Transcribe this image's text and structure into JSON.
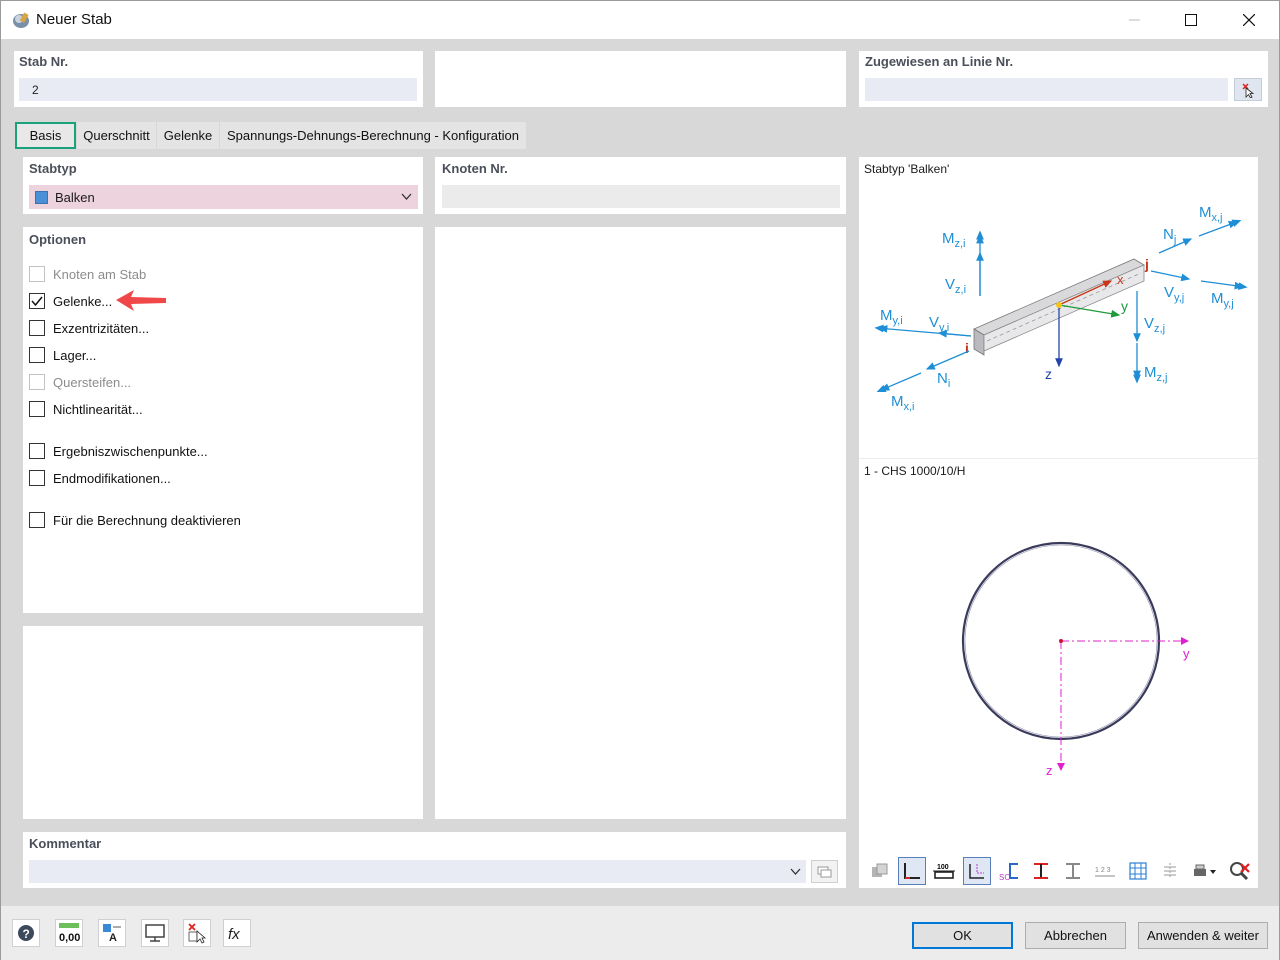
{
  "window": {
    "title": "Neuer Stab"
  },
  "header": {
    "stab_nr_label": "Stab Nr.",
    "stab_nr_value": "2",
    "zugewiesen_label": "Zugewiesen an Linie Nr.",
    "zugewiesen_value": ""
  },
  "tabs": [
    {
      "label": "Basis",
      "active": true
    },
    {
      "label": "Querschnitt"
    },
    {
      "label": "Gelenke"
    },
    {
      "label": "Spannungs-Dehnungs-Berechnung - Konfiguration"
    }
  ],
  "stabtyp": {
    "label": "Stabtyp",
    "value": "Balken",
    "swatch_color": "#4a90d9"
  },
  "knoten": {
    "label": "Knoten Nr.",
    "value": ""
  },
  "optionen": {
    "label": "Optionen",
    "items": [
      {
        "label": "Knoten am Stab",
        "checked": false,
        "disabled": true
      },
      {
        "label": "Gelenke...",
        "checked": true,
        "disabled": false
      },
      {
        "label": "Exzentrizitäten...",
        "checked": false,
        "disabled": false
      },
      {
        "label": "Lager...",
        "checked": false,
        "disabled": false
      },
      {
        "label": "Quersteifen...",
        "checked": false,
        "disabled": true
      },
      {
        "label": "Nichtlinearität...",
        "checked": false,
        "disabled": false
      },
      {
        "label": "Ergebniszwischenpunkte...",
        "checked": false,
        "disabled": false
      },
      {
        "label": "Endmodifikationen...",
        "checked": false,
        "disabled": false
      },
      {
        "label": "Für die Berechnung deaktivieren",
        "checked": false,
        "disabled": false
      }
    ]
  },
  "kommentar": {
    "label": "Kommentar",
    "value": ""
  },
  "preview": {
    "stabtyp_title": "Stabtyp 'Balken'",
    "section_title": "1 - CHS 1000/10/H",
    "force_color": "#1e8fd6",
    "labels": {
      "mzi": "M",
      "mzi_sub": "z,i",
      "vzi": "V",
      "vzi_sub": "z,i",
      "myi": "M",
      "myi_sub": "y,i",
      "vyi": "V",
      "vyi_sub": "y,i",
      "ni": "N",
      "ni_sub": "i",
      "mxi": "M",
      "mxi_sub": "x,i",
      "nj": "N",
      "nj_sub": "j",
      "mxj": "M",
      "mxj_sub": "x,j",
      "vyj": "V",
      "vyj_sub": "y,j",
      "myj": "M",
      "myj_sub": "y,j",
      "vzj": "V",
      "vzj_sub": "z,j",
      "mzj": "M",
      "mzj_sub": "z,j",
      "node_i": "i",
      "node_j": "j",
      "axis_x": "x",
      "axis_y": "y",
      "axis_z": "z",
      "section_y": "y",
      "section_z": "z"
    }
  },
  "buttons": {
    "ok": "OK",
    "cancel": "Abbrechen",
    "apply": "Anwenden & weiter"
  },
  "bottom_tools": {
    "units_label": "0,00"
  },
  "preview_tools": {
    "dim_label": "100",
    "num_label": "1 2 3"
  }
}
